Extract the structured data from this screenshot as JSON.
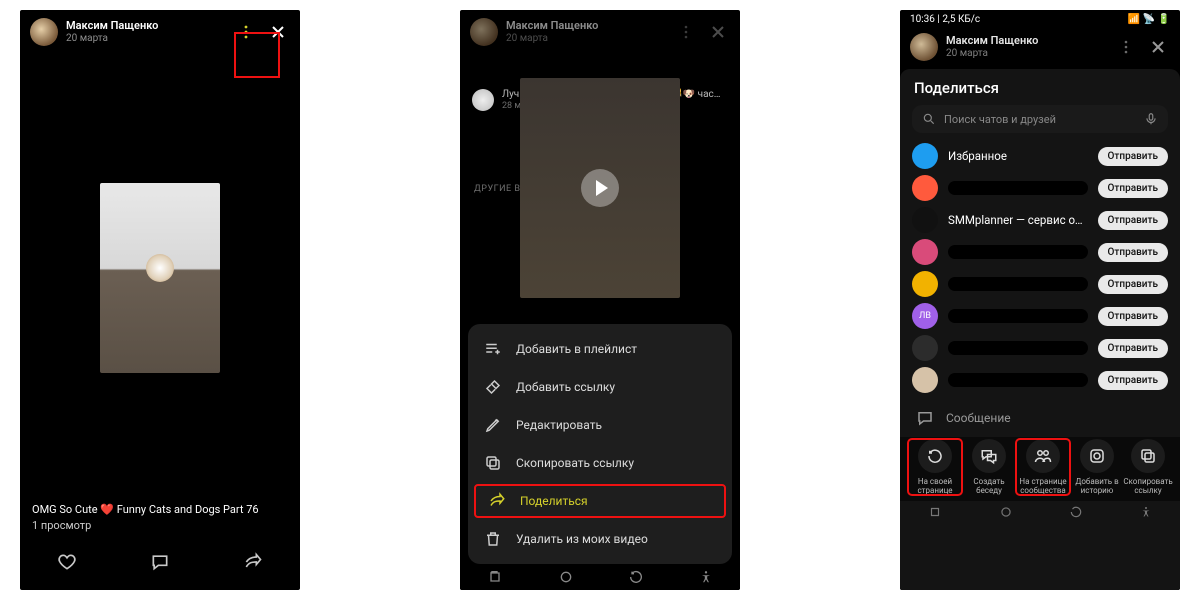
{
  "user": {
    "name": "Максим Пащенко",
    "date": "20 марта"
  },
  "s1": {
    "caption": "OMG So Cute ❤️ Funny Cats and Dogs Part 76",
    "views": "1 просмотр"
  },
  "s2": {
    "rec_title": "Лучшие смешные кошки и собачки 😺🐶 час…",
    "rec_sub": "28 млн просмотров · тыс. комментариев",
    "other_label": "ДРУГИЕ ВИДЕО",
    "menu": [
      "Добавить в плейлист",
      "Добавить ссылку",
      "Редактировать",
      "Скопировать ссылку",
      "Поделиться",
      "Удалить из моих видео"
    ]
  },
  "s3": {
    "time": "10:36",
    "speed": "2,5 КБ/с",
    "title": "Поделиться",
    "search": "Поиск чатов и друзей",
    "send": "Отправить",
    "contacts": [
      {
        "label": "Избранное",
        "color": "#1e9df0",
        "named": true
      },
      {
        "label": "",
        "color": "#ff5a3d",
        "named": false
      },
      {
        "label": "SMMplanner — сервис отло…",
        "color": "#111",
        "named": true
      },
      {
        "label": "",
        "color": "#d94b7a",
        "named": false
      },
      {
        "label": "",
        "color": "#f2b200",
        "named": false
      },
      {
        "label": "",
        "color": "#a060e8",
        "named": false,
        "initials": "ЛВ"
      },
      {
        "label": "",
        "color": "#2c2c2c",
        "named": false
      },
      {
        "label": "",
        "color": "#d6c2a8",
        "named": false
      }
    ],
    "message": "Сообщение",
    "actions": [
      "На своей странице",
      "Создать беседу",
      "На странице сообщества",
      "Добавить в историю",
      "Скопировать ссылку"
    ]
  }
}
